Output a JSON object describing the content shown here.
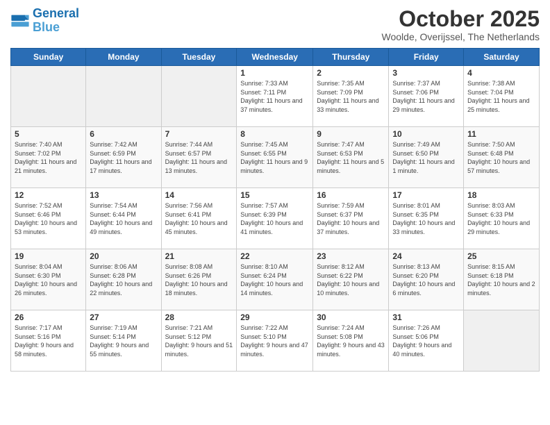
{
  "logo": {
    "line1": "General",
    "line2": "Blue"
  },
  "title": "October 2025",
  "location": "Woolde, Overijssel, The Netherlands",
  "weekdays": [
    "Sunday",
    "Monday",
    "Tuesday",
    "Wednesday",
    "Thursday",
    "Friday",
    "Saturday"
  ],
  "weeks": [
    [
      {
        "day": "",
        "info": ""
      },
      {
        "day": "",
        "info": ""
      },
      {
        "day": "",
        "info": ""
      },
      {
        "day": "1",
        "info": "Sunrise: 7:33 AM\nSunset: 7:11 PM\nDaylight: 11 hours and 37 minutes."
      },
      {
        "day": "2",
        "info": "Sunrise: 7:35 AM\nSunset: 7:09 PM\nDaylight: 11 hours and 33 minutes."
      },
      {
        "day": "3",
        "info": "Sunrise: 7:37 AM\nSunset: 7:06 PM\nDaylight: 11 hours and 29 minutes."
      },
      {
        "day": "4",
        "info": "Sunrise: 7:38 AM\nSunset: 7:04 PM\nDaylight: 11 hours and 25 minutes."
      }
    ],
    [
      {
        "day": "5",
        "info": "Sunrise: 7:40 AM\nSunset: 7:02 PM\nDaylight: 11 hours and 21 minutes."
      },
      {
        "day": "6",
        "info": "Sunrise: 7:42 AM\nSunset: 6:59 PM\nDaylight: 11 hours and 17 minutes."
      },
      {
        "day": "7",
        "info": "Sunrise: 7:44 AM\nSunset: 6:57 PM\nDaylight: 11 hours and 13 minutes."
      },
      {
        "day": "8",
        "info": "Sunrise: 7:45 AM\nSunset: 6:55 PM\nDaylight: 11 hours and 9 minutes."
      },
      {
        "day": "9",
        "info": "Sunrise: 7:47 AM\nSunset: 6:53 PM\nDaylight: 11 hours and 5 minutes."
      },
      {
        "day": "10",
        "info": "Sunrise: 7:49 AM\nSunset: 6:50 PM\nDaylight: 11 hours and 1 minute."
      },
      {
        "day": "11",
        "info": "Sunrise: 7:50 AM\nSunset: 6:48 PM\nDaylight: 10 hours and 57 minutes."
      }
    ],
    [
      {
        "day": "12",
        "info": "Sunrise: 7:52 AM\nSunset: 6:46 PM\nDaylight: 10 hours and 53 minutes."
      },
      {
        "day": "13",
        "info": "Sunrise: 7:54 AM\nSunset: 6:44 PM\nDaylight: 10 hours and 49 minutes."
      },
      {
        "day": "14",
        "info": "Sunrise: 7:56 AM\nSunset: 6:41 PM\nDaylight: 10 hours and 45 minutes."
      },
      {
        "day": "15",
        "info": "Sunrise: 7:57 AM\nSunset: 6:39 PM\nDaylight: 10 hours and 41 minutes."
      },
      {
        "day": "16",
        "info": "Sunrise: 7:59 AM\nSunset: 6:37 PM\nDaylight: 10 hours and 37 minutes."
      },
      {
        "day": "17",
        "info": "Sunrise: 8:01 AM\nSunset: 6:35 PM\nDaylight: 10 hours and 33 minutes."
      },
      {
        "day": "18",
        "info": "Sunrise: 8:03 AM\nSunset: 6:33 PM\nDaylight: 10 hours and 29 minutes."
      }
    ],
    [
      {
        "day": "19",
        "info": "Sunrise: 8:04 AM\nSunset: 6:30 PM\nDaylight: 10 hours and 26 minutes."
      },
      {
        "day": "20",
        "info": "Sunrise: 8:06 AM\nSunset: 6:28 PM\nDaylight: 10 hours and 22 minutes."
      },
      {
        "day": "21",
        "info": "Sunrise: 8:08 AM\nSunset: 6:26 PM\nDaylight: 10 hours and 18 minutes."
      },
      {
        "day": "22",
        "info": "Sunrise: 8:10 AM\nSunset: 6:24 PM\nDaylight: 10 hours and 14 minutes."
      },
      {
        "day": "23",
        "info": "Sunrise: 8:12 AM\nSunset: 6:22 PM\nDaylight: 10 hours and 10 minutes."
      },
      {
        "day": "24",
        "info": "Sunrise: 8:13 AM\nSunset: 6:20 PM\nDaylight: 10 hours and 6 minutes."
      },
      {
        "day": "25",
        "info": "Sunrise: 8:15 AM\nSunset: 6:18 PM\nDaylight: 10 hours and 2 minutes."
      }
    ],
    [
      {
        "day": "26",
        "info": "Sunrise: 7:17 AM\nSunset: 5:16 PM\nDaylight: 9 hours and 58 minutes."
      },
      {
        "day": "27",
        "info": "Sunrise: 7:19 AM\nSunset: 5:14 PM\nDaylight: 9 hours and 55 minutes."
      },
      {
        "day": "28",
        "info": "Sunrise: 7:21 AM\nSunset: 5:12 PM\nDaylight: 9 hours and 51 minutes."
      },
      {
        "day": "29",
        "info": "Sunrise: 7:22 AM\nSunset: 5:10 PM\nDaylight: 9 hours and 47 minutes."
      },
      {
        "day": "30",
        "info": "Sunrise: 7:24 AM\nSunset: 5:08 PM\nDaylight: 9 hours and 43 minutes."
      },
      {
        "day": "31",
        "info": "Sunrise: 7:26 AM\nSunset: 5:06 PM\nDaylight: 9 hours and 40 minutes."
      },
      {
        "day": "",
        "info": ""
      }
    ]
  ]
}
